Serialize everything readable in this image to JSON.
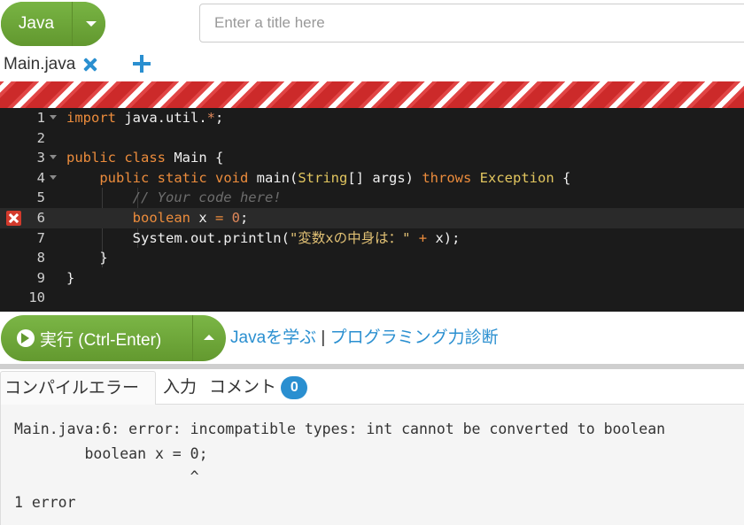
{
  "toolbar": {
    "language": "Java",
    "title_placeholder": "Enter a title here"
  },
  "file": {
    "name": "Main.java"
  },
  "editor": {
    "line_numbers": [
      "1",
      "2",
      "3",
      "4",
      "5",
      "6",
      "7",
      "8",
      "9",
      "10"
    ],
    "lines": {
      "l1": {
        "kw": "import",
        "rest": " java.util.",
        "star": "*",
        "semi": ";"
      },
      "l3": {
        "kw1": "public",
        "kw2": " class",
        "rest": " Main {"
      },
      "l4": {
        "indent": "    ",
        "kw1": "public",
        "kw2": " static",
        "kw3": " void",
        "name": " main(",
        "type": "String",
        "mid": "[] args) ",
        "kw4": "throws",
        "exc": " Exception",
        "end": " {"
      },
      "l5": {
        "indent": "        ",
        "comment": "// Your code here!"
      },
      "l6": {
        "indent": "        ",
        "kw": "boolean",
        "mid": " x ",
        "op": "=",
        "num": " 0",
        "end": ";"
      },
      "l7": {
        "indent": "        ",
        "pre": "System.out.println(",
        "str": "\"変数xの中身は：\"",
        "op": " +",
        "end": " x);"
      },
      "l8": {
        "text": "    }"
      },
      "l9": {
        "text": "}"
      }
    },
    "error_line": 6
  },
  "run": {
    "label": "実行 (Ctrl-Enter)",
    "link_learn": "Javaを学ぶ",
    "separator": " | ",
    "link_diagnosis": "プログラミング力診断"
  },
  "output_tabs": {
    "compile_error": "コンパイルエラー",
    "input": "入力",
    "comment": "コメント",
    "comment_count": "0"
  },
  "output": {
    "lines": [
      "Main.java:6: error: incompatible types: int cannot be converted to boolean",
      "        boolean x = 0;",
      "                    ^",
      "1 error"
    ]
  },
  "colors": {
    "accent_green": "#6aa33a",
    "accent_blue": "#2a8fd0",
    "error_red": "#d33a2c",
    "editor_bg": "#1b1b1b"
  }
}
